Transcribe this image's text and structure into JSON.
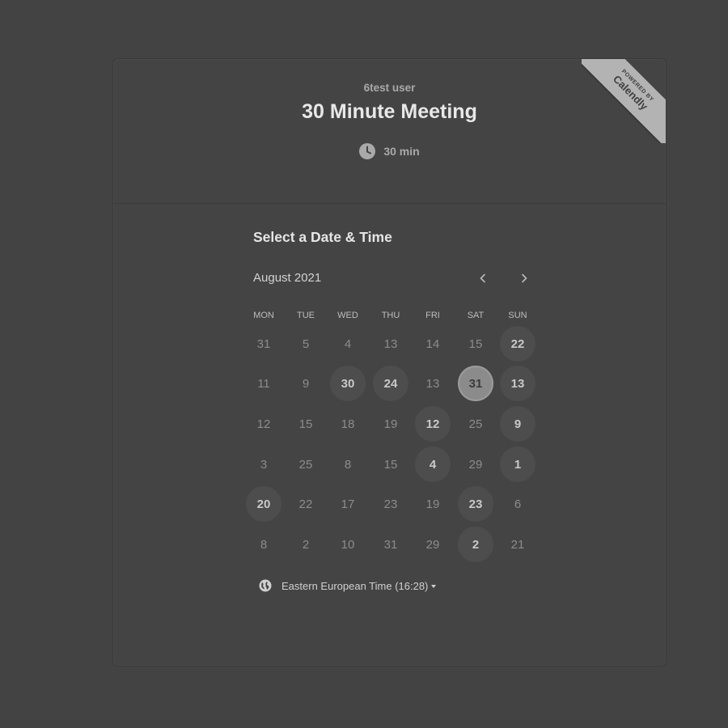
{
  "header": {
    "organizer": "6test user",
    "event_title": "30 Minute Meeting",
    "duration": "30 min",
    "duration_icon": "clock-icon"
  },
  "ribbon": {
    "line1": "POWERED BY",
    "line2": "Calendly"
  },
  "scheduler": {
    "section_title": "Select a Date & Time",
    "month_label": "August 2021",
    "prev_icon": "chevron-left-icon",
    "next_icon": "chevron-right-icon",
    "weekdays": [
      "MON",
      "TUE",
      "WED",
      "THU",
      "FRI",
      "SAT",
      "SUN"
    ],
    "weeks": [
      [
        {
          "d": "31"
        },
        {
          "d": "5"
        },
        {
          "d": "4"
        },
        {
          "d": "13"
        },
        {
          "d": "14"
        },
        {
          "d": "15"
        },
        {
          "d": "22",
          "state": "available"
        }
      ],
      [
        {
          "d": "11"
        },
        {
          "d": "9"
        },
        {
          "d": "30",
          "state": "available"
        },
        {
          "d": "24",
          "state": "available"
        },
        {
          "d": "13"
        },
        {
          "d": "31",
          "state": "selected"
        },
        {
          "d": "13",
          "state": "available"
        }
      ],
      [
        {
          "d": "12"
        },
        {
          "d": "15"
        },
        {
          "d": "18"
        },
        {
          "d": "19"
        },
        {
          "d": "12",
          "state": "available"
        },
        {
          "d": "25"
        },
        {
          "d": "9",
          "state": "available"
        }
      ],
      [
        {
          "d": "3"
        },
        {
          "d": "25"
        },
        {
          "d": "8"
        },
        {
          "d": "15"
        },
        {
          "d": "4",
          "state": "available"
        },
        {
          "d": "29"
        },
        {
          "d": "1",
          "state": "available"
        }
      ],
      [
        {
          "d": "20",
          "state": "available"
        },
        {
          "d": "22"
        },
        {
          "d": "17"
        },
        {
          "d": "23"
        },
        {
          "d": "19"
        },
        {
          "d": "23",
          "state": "available"
        },
        {
          "d": "6"
        }
      ],
      [
        {
          "d": "8"
        },
        {
          "d": "2"
        },
        {
          "d": "10"
        },
        {
          "d": "31"
        },
        {
          "d": "29"
        },
        {
          "d": "2",
          "state": "available"
        },
        {
          "d": "21"
        }
      ]
    ],
    "timezone_icon": "globe-icon",
    "timezone_label": "Eastern European Time (16:28)"
  },
  "colors": {
    "page_background": "#434343",
    "available_day_bg": "#4d4d4d",
    "selected_day_bg": "#8b8b8b",
    "ribbon_bg": "#b3b3b3"
  }
}
